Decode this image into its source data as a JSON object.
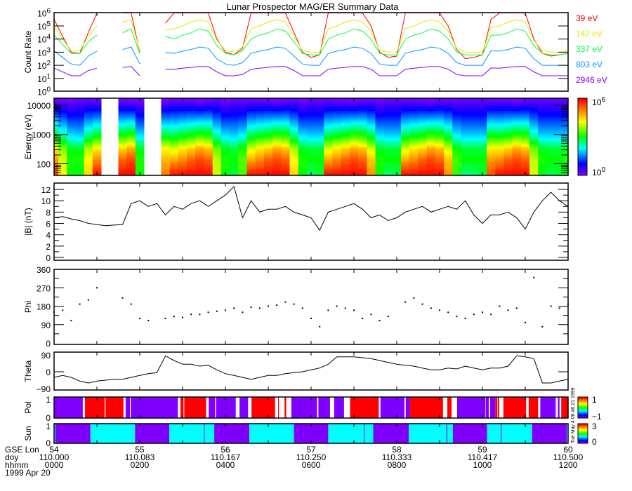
{
  "title": "Lunar Prospector MAG/ER Summary Data",
  "colors": {
    "ch39": "#ff0000",
    "ch142": "#e6e600",
    "ch337": "#00ff40",
    "ch803": "#0099ff",
    "ch2946": "#8000ff",
    "pol_pos": "#ff0000",
    "pol_neg": "#8000ff",
    "sun_lit": "#00ffff",
    "sun_dark": "#8000ff"
  },
  "timestamp": "Tue May 4 08:46:21 1999",
  "x_axis": {
    "row_labels": [
      "GSE Lon",
      "doy",
      "hhmm"
    ],
    "date": "1999 Apr 20",
    "gse_lon": [
      "54",
      "55",
      "56",
      "57",
      "58",
      "59",
      "60"
    ],
    "doy": [
      "110.000",
      "110.083",
      "110.167",
      "110.250",
      "110.333",
      "110.417",
      "110.500"
    ],
    "hhmm": [
      "0000",
      "0200",
      "0400",
      "0600",
      "0800",
      "1000",
      "1200"
    ]
  },
  "chart_data": [
    {
      "type": "line",
      "panel": "count-rate",
      "ylabel": "Count Rate",
      "yscale": "log",
      "ylim": [
        1,
        1000000
      ],
      "yticks": [
        "10^0",
        "10^1",
        "10^2",
        "10^3",
        "10^4",
        "10^5",
        "10^6"
      ],
      "x_unit": "hours UT",
      "x": [
        0,
        0.2,
        0.4,
        0.6,
        0.8,
        1,
        1.2,
        1.4,
        1.6,
        1.8,
        2,
        2.2,
        2.4,
        2.6,
        2.8,
        3,
        3.2,
        3.4,
        3.6,
        3.8,
        4,
        4.2,
        4.4,
        4.6,
        4.8,
        5,
        5.2,
        5.4,
        5.6,
        5.8,
        6,
        6.2,
        6.4,
        6.6,
        6.8,
        7,
        7.2,
        7.4,
        7.6,
        7.8,
        8,
        8.2,
        8.4,
        8.6,
        8.8,
        9,
        9.2,
        9.4,
        9.6,
        9.8,
        10,
        10.2,
        10.4,
        10.6,
        10.8,
        11,
        11.2,
        11.4,
        11.6,
        11.8,
        12
      ],
      "series": [
        {
          "name": "39 eV",
          "color": "#ff0000",
          "values": [
            320000,
            16000,
            1000,
            800,
            32000,
            1000000,
            null,
            null,
            1000000,
            1000000,
            1000,
            null,
            null,
            160000,
            1000000,
            1000000,
            1000000,
            1000000,
            1000000,
            10000,
            1000,
            630,
            2000,
            1000000,
            1000000,
            1000000,
            1000000,
            1000000,
            32000,
            1000,
            400,
            630,
            1000000,
            1000000,
            1000000,
            1000000,
            1000000,
            100000,
            1000,
            400,
            500,
            1000000,
            1000000,
            1000000,
            1000000,
            1000000,
            100000,
            1600,
            320,
            400,
            630,
            320000,
            1000000,
            1000000,
            1000000,
            1000000,
            10000,
            800,
            500,
            630,
            800
          ]
        },
        {
          "name": "142 eV",
          "color": "#e6e600",
          "values": [
            80000,
            10000,
            1300,
            1300,
            16000,
            100000,
            null,
            null,
            200000,
            300000,
            1300,
            null,
            null,
            50000,
            60000,
            100000,
            200000,
            300000,
            200000,
            8000,
            1300,
            1000,
            2500,
            60000,
            100000,
            200000,
            300000,
            200000,
            16000,
            1300,
            1000,
            1000,
            60000,
            100000,
            200000,
            300000,
            200000,
            40000,
            1300,
            1000,
            1000,
            60000,
            100000,
            200000,
            300000,
            200000,
            40000,
            2000,
            1000,
            1000,
            1000,
            80000,
            100000,
            200000,
            300000,
            200000,
            8000,
            1300,
            1000,
            1000,
            1300
          ]
        },
        {
          "name": "337 eV",
          "color": "#00ff40",
          "values": [
            20000,
            4000,
            800,
            800,
            6300,
            20000,
            null,
            null,
            30000,
            60000,
            800,
            null,
            null,
            16000,
            10000,
            20000,
            30000,
            60000,
            40000,
            3200,
            800,
            630,
            1260,
            10000,
            20000,
            30000,
            60000,
            40000,
            6300,
            800,
            630,
            630,
            10000,
            20000,
            30000,
            60000,
            40000,
            10000,
            800,
            630,
            630,
            10000,
            20000,
            30000,
            60000,
            40000,
            10000,
            1000,
            630,
            630,
            630,
            20000,
            20000,
            30000,
            60000,
            40000,
            3200,
            800,
            630,
            630,
            800
          ]
        },
        {
          "name": "803 eV",
          "color": "#0099ff",
          "values": [
            1260,
            400,
            126,
            100,
            500,
            1200,
            null,
            null,
            1600,
            2500,
            126,
            null,
            null,
            1000,
            800,
            1200,
            1600,
            2500,
            2000,
            316,
            126,
            100,
            160,
            800,
            1200,
            1600,
            2500,
            2000,
            500,
            126,
            100,
            100,
            800,
            1200,
            1600,
            2500,
            2000,
            800,
            126,
            100,
            100,
            800,
            1200,
            1600,
            2500,
            2000,
            800,
            160,
            100,
            100,
            100,
            1260,
            1200,
            1600,
            2500,
            2000,
            316,
            100,
            100,
            100,
            100
          ]
        },
        {
          "name": "2946 eV",
          "color": "#8000ff",
          "values": [
            63,
            32,
            16,
            16,
            40,
            60,
            null,
            null,
            70,
            80,
            16,
            null,
            null,
            50,
            50,
            60,
            70,
            80,
            80,
            32,
            16,
            16,
            20,
            50,
            60,
            70,
            80,
            80,
            40,
            16,
            16,
            16,
            50,
            60,
            70,
            80,
            80,
            50,
            16,
            16,
            16,
            50,
            60,
            70,
            80,
            80,
            50,
            20,
            16,
            16,
            16,
            63,
            60,
            70,
            80,
            80,
            32,
            16,
            16,
            16,
            16
          ]
        }
      ]
    },
    {
      "type": "heatmap",
      "panel": "energy-spectrogram",
      "ylabel": "Energy (eV)",
      "yscale": "log",
      "ylim": [
        39,
        17000
      ],
      "yticks": [
        "100",
        "1000",
        "10000"
      ],
      "colorbar": {
        "scale": "log",
        "range": [
          1,
          1000000
        ],
        "labels": [
          "10^0",
          "10^6"
        ]
      },
      "source": "count-rate channels"
    },
    {
      "type": "line",
      "panel": "field-magnitude",
      "ylabel": "|B| (nT)",
      "ylim": [
        0,
        13
      ],
      "yticks": [
        "0",
        "2",
        "4",
        "6",
        "8",
        "10",
        "12"
      ],
      "values": [
        7,
        7.2,
        6.8,
        6.5,
        6,
        5.8,
        5.6,
        5.7,
        5.8,
        9.5,
        10,
        9,
        9.5,
        7.5,
        9,
        8.5,
        9.5,
        10,
        9,
        10,
        11,
        12.5,
        7,
        10,
        8,
        8.5,
        8.5,
        9,
        8,
        7.5,
        7,
        4.8,
        8,
        8.5,
        9,
        9.5,
        8.5,
        7,
        7.5,
        6.5,
        7,
        8,
        8.5,
        9,
        8,
        8.5,
        9,
        8.5,
        10,
        7.5,
        6,
        7.5,
        7.5,
        8,
        7,
        5,
        8,
        10,
        11.5,
        10,
        9
      ]
    },
    {
      "type": "scatter",
      "panel": "phi",
      "ylabel": "Phi",
      "ylim": [
        0,
        360
      ],
      "yticks": [
        "0",
        "90",
        "180",
        "270",
        "360"
      ],
      "values": [
        150,
        160,
        110,
        190,
        210,
        270,
        null,
        null,
        220,
        190,
        120,
        110,
        null,
        120,
        130,
        125,
        140,
        140,
        150,
        155,
        160,
        170,
        150,
        175,
        170,
        180,
        185,
        200,
        190,
        170,
        120,
        80,
        160,
        180,
        170,
        160,
        120,
        140,
        110,
        130,
        null,
        200,
        220,
        190,
        170,
        160,
        150,
        130,
        120,
        140,
        150,
        140,
        180,
        160,
        170,
        100,
        320,
        80,
        180,
        170,
        190
      ]
    },
    {
      "type": "line",
      "panel": "theta",
      "ylabel": "Theta",
      "ylim": [
        -90,
        90
      ],
      "yticks": [
        "-90",
        "0",
        "90"
      ],
      "values": [
        -30,
        -20,
        -30,
        -50,
        -60,
        -50,
        -45,
        -40,
        -40,
        -30,
        -20,
        -10,
        -5,
        85,
        60,
        40,
        40,
        30,
        35,
        10,
        -10,
        -20,
        -30,
        -40,
        -30,
        -20,
        -20,
        -10,
        -5,
        0,
        10,
        20,
        40,
        80,
        80,
        80,
        75,
        70,
        60,
        50,
        40,
        35,
        30,
        20,
        10,
        10,
        20,
        15,
        30,
        20,
        10,
        20,
        20,
        30,
        85,
        80,
        70,
        -60,
        -60,
        -50,
        -40
      ]
    },
    {
      "type": "heatmap",
      "panel": "polarity",
      "ylabel": "Pol",
      "yticks": [
        "0",
        "1"
      ],
      "colorbar": {
        "range": [
          -1,
          1
        ],
        "labels": [
          "-1",
          "1"
        ]
      },
      "segments": [
        [
          0,
          0.67,
          -1
        ],
        [
          0.72,
          1.18,
          1
        ],
        [
          1.2,
          1.62,
          1
        ],
        [
          1.67,
          1.77,
          -1
        ],
        [
          1.79,
          2.89,
          -1
        ],
        [
          2.95,
          3.02,
          1
        ],
        [
          3.04,
          3.55,
          1
        ],
        [
          3.61,
          3.76,
          -1
        ],
        [
          3.78,
          4.24,
          -1
        ],
        [
          4.33,
          4.53,
          -1
        ],
        [
          4.61,
          5.16,
          1
        ],
        [
          5.23,
          5.25,
          1
        ],
        [
          5.38,
          5.42,
          1
        ],
        [
          5.54,
          6.14,
          -1
        ],
        [
          6.17,
          6.44,
          -1
        ],
        [
          6.54,
          6.77,
          -1
        ],
        [
          6.91,
          7.58,
          1
        ],
        [
          7.62,
          8.18,
          -1
        ],
        [
          8.21,
          8.31,
          -1
        ],
        [
          8.31,
          9.08,
          1
        ],
        [
          9.18,
          9.28,
          1
        ],
        [
          9.41,
          10.07,
          -1
        ],
        [
          10.08,
          10.15,
          -1
        ],
        [
          10.18,
          10.3,
          -1
        ],
        [
          10.3,
          10.35,
          1
        ],
        [
          10.36,
          10.39,
          1
        ],
        [
          10.49,
          11.02,
          1
        ],
        [
          11.08,
          11.3,
          1
        ],
        [
          11.35,
          11.71,
          -1
        ],
        [
          11.76,
          11.8,
          -1
        ],
        [
          11.84,
          12,
          1
        ]
      ]
    },
    {
      "type": "heatmap",
      "panel": "sunlight",
      "ylabel": "Sun",
      "yticks": [
        "0",
        "1"
      ],
      "colorbar": {
        "range": [
          0,
          3
        ],
        "labels": [
          "0",
          "3"
        ]
      },
      "segments": [
        [
          0,
          0.03,
          1
        ],
        [
          0.03,
          0.85,
          0
        ],
        [
          0.85,
          1.89,
          1
        ],
        [
          1.89,
          2.69,
          0
        ],
        [
          2.69,
          3.5,
          1
        ],
        [
          3.5,
          3.52,
          0
        ],
        [
          3.52,
          3.74,
          1
        ],
        [
          3.74,
          4.56,
          0
        ],
        [
          4.56,
          5.6,
          1
        ],
        [
          5.6,
          6.4,
          0
        ],
        [
          6.4,
          7.23,
          1
        ],
        [
          7.23,
          7.25,
          0
        ],
        [
          7.25,
          7.45,
          1
        ],
        [
          7.45,
          8.28,
          0
        ],
        [
          8.28,
          9.16,
          1
        ],
        [
          9.16,
          9.18,
          0
        ],
        [
          9.18,
          9.31,
          1
        ],
        [
          9.31,
          10.11,
          0
        ],
        [
          10.11,
          10.43,
          1
        ],
        [
          10.43,
          10.45,
          0
        ],
        [
          10.45,
          11.16,
          1
        ],
        [
          11.16,
          11.97,
          0
        ],
        [
          11.97,
          12,
          1
        ]
      ]
    }
  ]
}
